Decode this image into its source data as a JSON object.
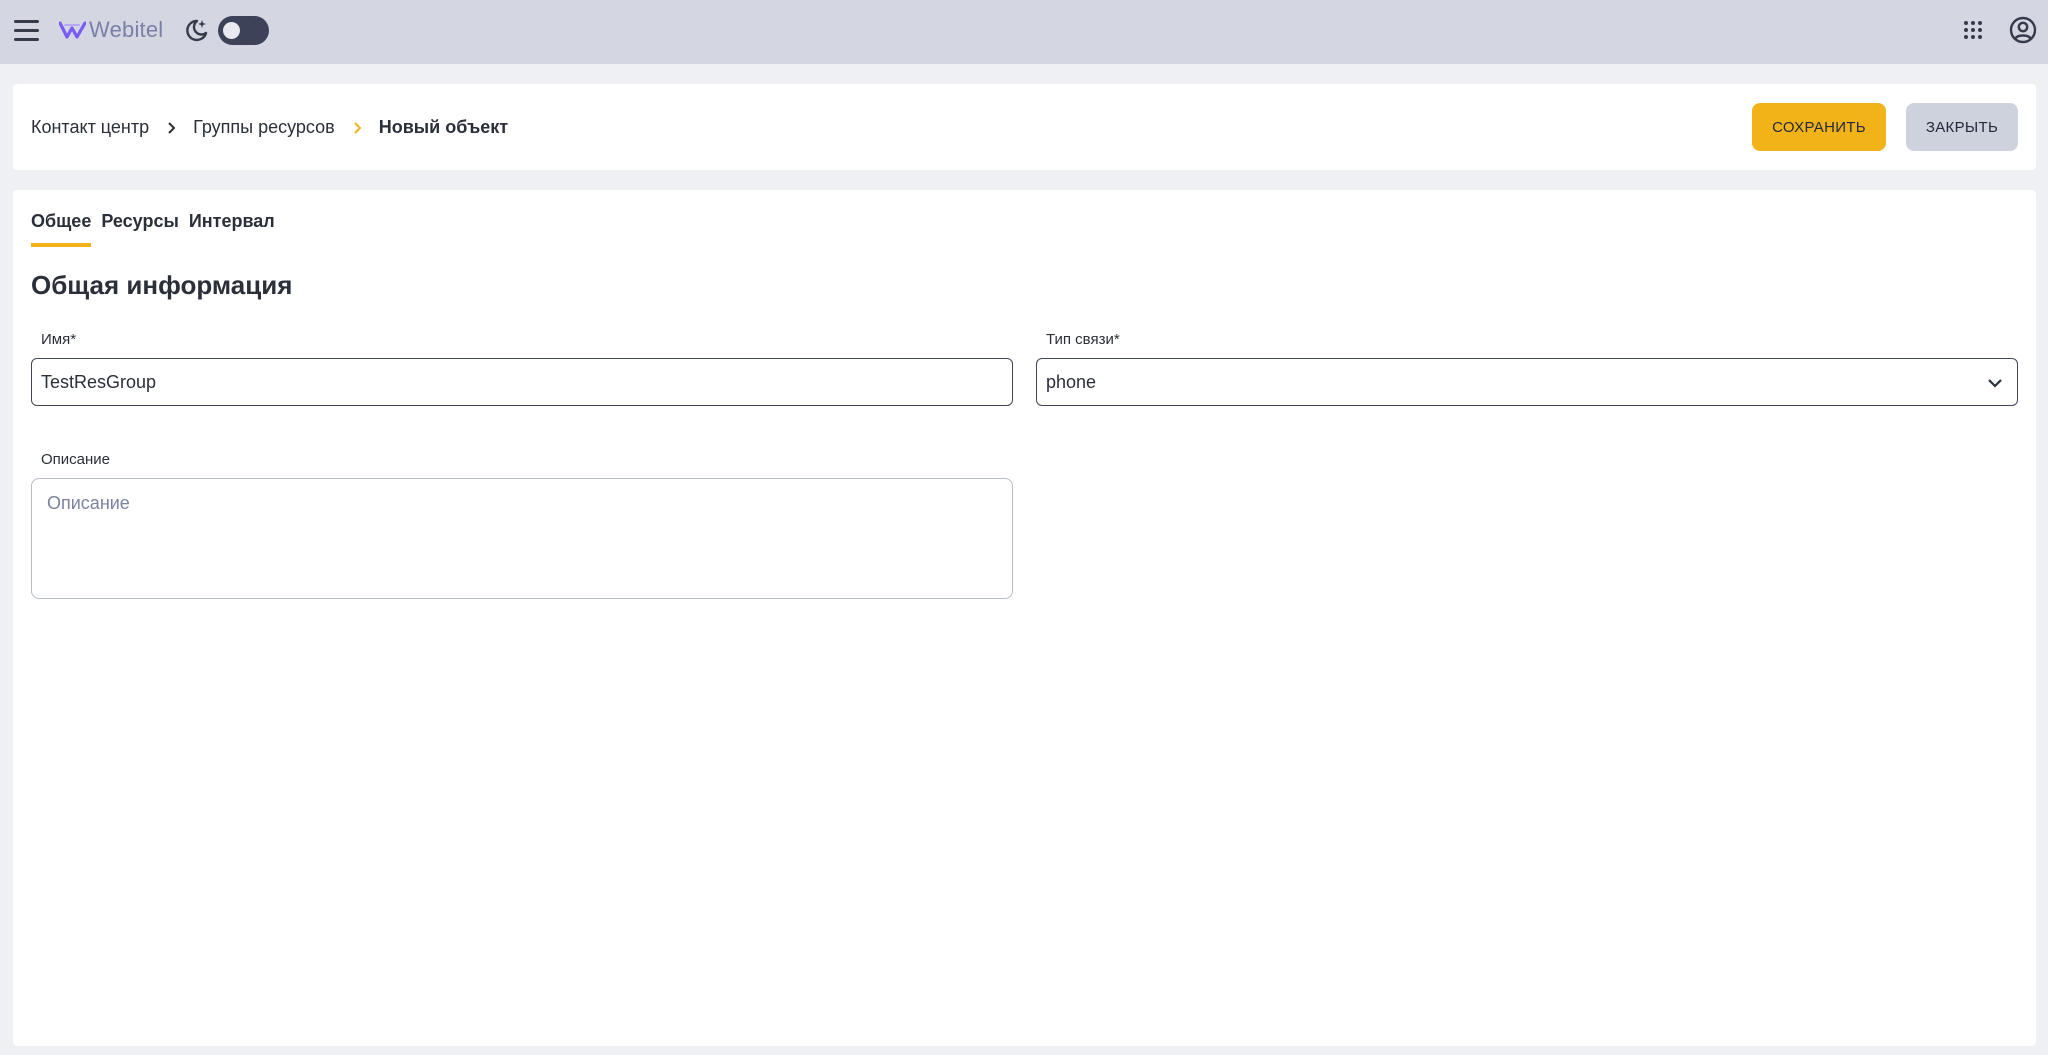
{
  "topbar": {
    "logo_text": "Webitel",
    "brand_color": "#7a5af8",
    "icons": [
      "menu-icon",
      "webitel-logo",
      "moon-icon",
      "theme-toggle",
      "apps-grid-icon",
      "account-icon"
    ],
    "theme_dark_mode": false
  },
  "breadcrumb": {
    "items": [
      "Контакт центр",
      "Группы ресурсов"
    ],
    "current": "Новый объект"
  },
  "actions": {
    "save_label": "СОХРАНИТЬ",
    "close_label": "ЗАКРЫТЬ",
    "save_color": "#f2b319",
    "close_color": "#ced2dd"
  },
  "tabs": [
    "Общее",
    "Ресурсы",
    "Интервал"
  ],
  "active_tab": "Общее",
  "section": {
    "title": "Общая информация"
  },
  "form": {
    "name": {
      "label": "Имя*",
      "value": "TestResGroup"
    },
    "type": {
      "label": "Тип связи*",
      "value": "phone"
    },
    "description": {
      "label": "Описание",
      "placeholder": "Описание",
      "value": ""
    }
  }
}
